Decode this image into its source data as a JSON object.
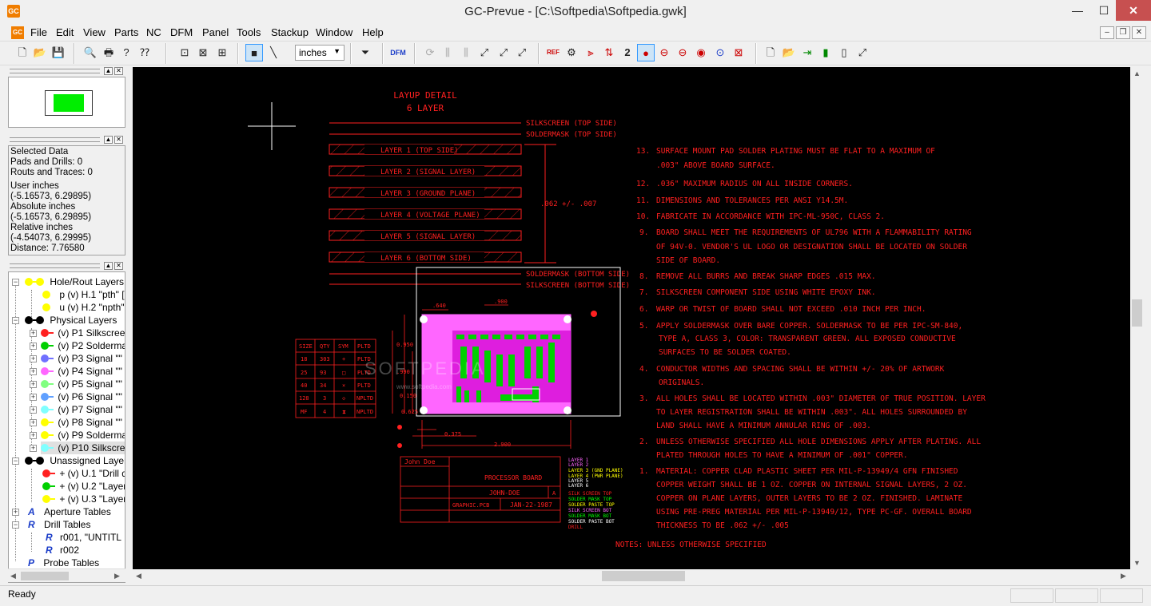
{
  "app": {
    "title": "GC-Prevue - [C:\\Softpedia\\Softpedia.gwk]",
    "logo": "GC"
  },
  "window_controls": {
    "minimize": "—",
    "maximize": "☐",
    "close": "✕"
  },
  "menu": [
    "File",
    "Edit",
    "View",
    "Parts",
    "NC",
    "DFM",
    "Panel",
    "Tools",
    "Stackup",
    "Window",
    "Help"
  ],
  "toolbar": {
    "units": "inches",
    "dfm_label": "DFM"
  },
  "info_panel": {
    "lines": [
      "Selected Data",
      "Pads and Drills: 0",
      "Routs and Traces: 0",
      "",
      "User inches",
      "(-5.16573,  6.29895)",
      "Absolute inches",
      "(-5.16573,  6.29895)",
      "Relative inches",
      "(-4.54073,  6.29995)",
      "Distance:  7.76580"
    ]
  },
  "tree": {
    "hole_rout_layers": "Hole/Rout Layers",
    "hole_items": [
      "p (v) H.1 \"pth\" [r",
      "u (v) H.2 \"npth\""
    ],
    "physical_layers": "Physical Layers",
    "physical_items": [
      {
        "label": "(v) P1 Silkscreer",
        "color": "#ff2020"
      },
      {
        "label": "(v) P2 Soldermas",
        "color": "#00d000"
      },
      {
        "label": "(v) P3 Signal \"\"",
        "color": "#7070ff"
      },
      {
        "label": "(v) P4 Signal \"\" i",
        "color": "#ff66ff"
      },
      {
        "label": "(v) P5 Signal \"\" i",
        "color": "#80ff80"
      },
      {
        "label": "(v) P6 Signal \"\" i",
        "color": "#60a0ff"
      },
      {
        "label": "(v) P7 Signal \"\" i",
        "color": "#80ffff"
      },
      {
        "label": "(v) P8 Signal \"\"",
        "color": "#ffff00"
      },
      {
        "label": "(v) P9 Soldermas",
        "color": "#ffff00"
      },
      {
        "label": "(v) P10 Silkscree",
        "color": "#80ffff"
      }
    ],
    "unassigned_layers": "Unassigned Layers",
    "unassigned_items": [
      {
        "label": "+ (v) U.1 \"Drill dr",
        "color": "#ff2020"
      },
      {
        "label": "+ (v) U.2 \"Layer",
        "color": "#00d000"
      },
      {
        "label": "+ (v) U.3 \"Layer\"",
        "color": "#ffff00"
      }
    ],
    "aperture_tables": "Aperture Tables",
    "drill_tables": "Drill Tables",
    "drill_items": [
      "r001, \"UNTITL",
      "r002"
    ],
    "probe_tables": "Probe Tables"
  },
  "status": {
    "text": "Ready"
  },
  "colors": {
    "cad_red": "#ff2020",
    "canvas": "#000000",
    "board_pink": "#ff66ff",
    "pad_green": "#00d000"
  },
  "drawing": {
    "layup_title": [
      "LAYUP DETAIL",
      "6 LAYER"
    ],
    "silkscreen_top": "SILKSCREEN  (TOP SIDE)",
    "soldermask_top": "SOLDERMASK  (TOP SIDE)",
    "layers": [
      "LAYER 1    (TOP SIDE)",
      "LAYER 2    (SIGNAL LAYER)",
      "LAYER 3    (GROUND PLANE)",
      "LAYER 4    (VOLTAGE PLANE)",
      "LAYER 5    (SIGNAL LAYER)",
      "LAYER 6    (BOTTOM SIDE)"
    ],
    "thickness": ".062 +/- .007",
    "soldermask_bottom": "SOLDERMASK  (BOTTOM SIDE)",
    "silkscreen_bottom": "SILKSCREEN  (BOTTOM SIDE)",
    "drill_table": {
      "headers": [
        "SIZE",
        "QTY",
        "SYM",
        "PLTD"
      ],
      "rows": [
        [
          "18",
          "303",
          "+",
          "PLTD"
        ],
        [
          "25",
          "93",
          "□",
          "PLTD"
        ],
        [
          "40",
          "34",
          "×",
          "PLTD"
        ],
        [
          "128",
          "3",
          "◇",
          "NPLTD"
        ],
        [
          "MF",
          "4",
          "⧗",
          "NPLTD"
        ]
      ]
    },
    "dims": [
      ".640",
      ".900",
      "0.950",
      ".990",
      "0.150",
      "0.375",
      "2.900",
      "0.625"
    ],
    "notes": [
      [
        "13.",
        "SURFACE MOUNT PAD SOLDER PLATING MUST BE FLAT     TO A MAXIMUM OF",
        ".003\" ABOVE BOARD SURFACE."
      ],
      [
        "12.",
        ".036\" MAXIMUM RADIUS ON ALL INSIDE CORNERS."
      ],
      [
        "11.",
        "DIMENSIONS AND TOLERANCES PER ANSI Y14.5M."
      ],
      [
        "10.",
        "FABRICATE IN ACCORDANCE WITH IPC-ML-950C, CLASS 2."
      ],
      [
        "9.",
        "BOARD SHALL MEET THE REQUIREMENTS OF UL796 WITH     A FLAMMABILITY RATING",
        "OF 94V-0. VENDOR'S UL LOGO OR DESIGNATION SHALL BE     LOCATED ON SOLDER",
        "SIDE OF BOARD."
      ],
      [
        "8.",
        "REMOVE ALL BURRS AND BREAK SHARP EDGES .015 MAX."
      ],
      [
        "7.",
        "SILKSCREEN COMPONENT SIDE USING WHITE EPOXY INK."
      ],
      [
        "6.",
        "WARP OR TWIST OF BOARD SHALL NOT EXCEED .010 INCH      PER INCH."
      ],
      [
        "5.",
        "APPLY SOLDERMASK OVER BARE COPPER.  SOLDERMASK TO BE     PER IPC-SM-840,",
        "TYPE A, CLASS 3, COLOR: TRANSPARENT GREEN.  ALL EXPOSED     CONDUCTIVE",
        "SURFACES TO BE SOLDER COATED."
      ],
      [
        "4.",
        "CONDUCTOR WIDTHS AND SPACING SHALL BE WITHIN +/- 20%     OF ARTWORK",
        "ORIGINALS."
      ],
      [
        "3.",
        "ALL HOLES SHALL BE LOCATED WITHIN .003\" DIAMETER OF TRUE     POSITION. LAYER",
        "TO LAYER REGISTRATION SHALL BE WITHIN .003\".  ALL HOLES SURROUNDED BY",
        "LAND SHALL HAVE A MINIMUM ANNULAR RING OF .003."
      ],
      [
        "2.",
        "UNLESS OTHERWISE SPECIFIED ALL HOLE DIMENSIONS APPLY  AFTER PLATING. ALL",
        "PLATED THROUGH HOLES TO HAVE A MINIMUM OF .001\" COPPER."
      ],
      [
        "1.",
        "MATERIAL:  COPPER CLAD PLASTIC SHEET PER MIL-P-13949/4     GFN FINISHED",
        "COPPER WEIGHT SHALL BE 1 OZ. COPPER ON INTERNAL SIGNAL LAYERS, 2 OZ.",
        "COPPER ON PLANE LAYERS, OUTER LAYERS TO BE 2 OZ. FINISHED.  LAMINATE",
        "USING PRE-PREG MATERIAL PER MIL-P-13949/12, TYPE PC-GF. OVERALL BOARD",
        "THICKNESS TO BE .062 +/- .005"
      ]
    ],
    "notes_footer": "NOTES:  UNLESS OTHERWISE SPECIFIED",
    "title_block": {
      "company": "John Doe",
      "title": "PROCESSOR BOARD",
      "drawn": "JOHN-DOE",
      "date": "JAN-22-1987",
      "rev": "A",
      "file": "GRAPHIC.PCB"
    },
    "layer_legend": [
      {
        "text": "LAYER 1",
        "color": "#ff66ff"
      },
      {
        "text": "LAYER 2",
        "color": "#ff66ff"
      },
      {
        "text": "LAYER 3 (GND PLANE)",
        "color": "#ffff00"
      },
      {
        "text": "LAYER 4 (PWR PLANE)",
        "color": "#ffff00"
      },
      {
        "text": "LAYER 5",
        "color": "#ffffff"
      },
      {
        "text": "LAYER 6",
        "color": "#ffffff"
      },
      {
        "text": "SILK SCREEN TOP",
        "color": "#ff2020"
      },
      {
        "text": "SOLDER MASK TOP",
        "color": "#00ff00"
      },
      {
        "text": "SOLDER PASTE TOP",
        "color": "#ffff00"
      },
      {
        "text": "SILK SCREEN BOT",
        "color": "#ff66ff"
      },
      {
        "text": "SOLDER MASK BOT",
        "color": "#00ff00"
      },
      {
        "text": "SOLDER PASTE BOT",
        "color": "#ffffff"
      },
      {
        "text": "DRILL",
        "color": "#ff2020"
      }
    ],
    "watermark": "SOFTPEDIA",
    "watermark_url": "www.softpedia.com"
  }
}
